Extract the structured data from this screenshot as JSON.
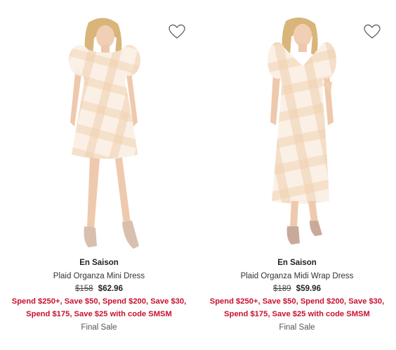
{
  "products": [
    {
      "brand": "En Saison",
      "name": "Plaid Organza Mini Dress",
      "original_price": "$158",
      "sale_price": "$62.96",
      "promo": "Spend $250+, Save $50, Spend $200, Save $30, Spend $175, Save $25 with code SMSM",
      "final_sale": "Final Sale"
    },
    {
      "brand": "En Saison",
      "name": "Plaid Organza Midi Wrap Dress",
      "original_price": "$189",
      "sale_price": "$59.96",
      "promo": "Spend $250+, Save $50, Spend $200, Save $30, Spend $175, Save $25 with code SMSM",
      "final_sale": "Final Sale"
    }
  ],
  "icons": {
    "wishlist": "heart-outline-icon"
  },
  "colors": {
    "promo": "#c8102e",
    "dress": "#f3d9c4",
    "plaid": "#e8b98f"
  }
}
